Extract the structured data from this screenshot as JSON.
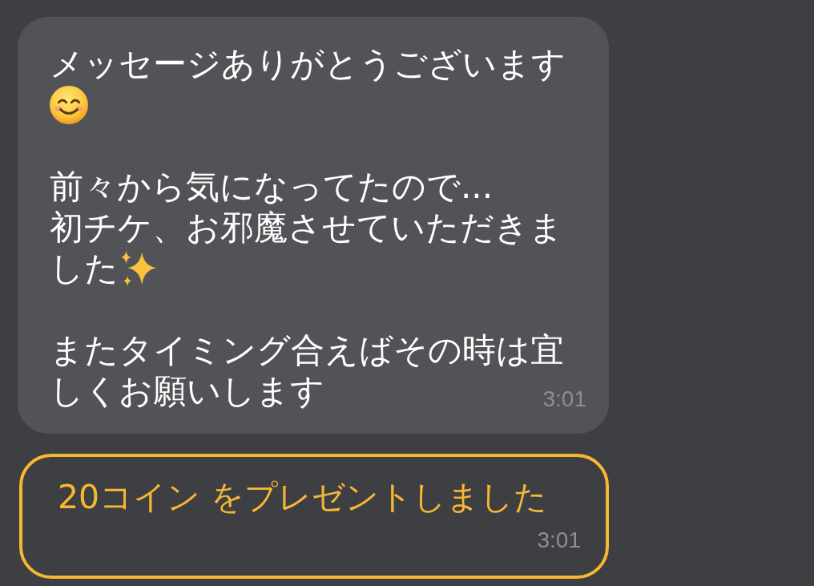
{
  "messages": [
    {
      "kind": "text",
      "paragraphs": [
        {
          "lines": [
            {
              "segments": [
                {
                  "kind": "text",
                  "text": "メッセージありがとうございます"
                }
              ]
            },
            {
              "segments": [
                {
                  "kind": "smile"
                }
              ]
            }
          ]
        },
        {
          "lines": [
            {
              "segments": [
                {
                  "kind": "text",
                  "text": "前々から気になってたので..."
                }
              ]
            },
            {
              "segments": [
                {
                  "kind": "text",
                  "text": "初チケ、お邪魔させていただきま"
                }
              ]
            },
            {
              "segments": [
                {
                  "kind": "text",
                  "text": "した"
                },
                {
                  "kind": "sparkles"
                }
              ]
            }
          ]
        },
        {
          "lines": [
            {
              "segments": [
                {
                  "kind": "text",
                  "text": "またタイミング合えばその時は宜"
                }
              ]
            },
            {
              "segments": [
                {
                  "kind": "text",
                  "text": "しくお願いします"
                }
              ]
            }
          ]
        }
      ],
      "time": "3:01"
    },
    {
      "kind": "gift",
      "text": "20コイン をプレゼントしました",
      "time": "3:01"
    }
  ]
}
